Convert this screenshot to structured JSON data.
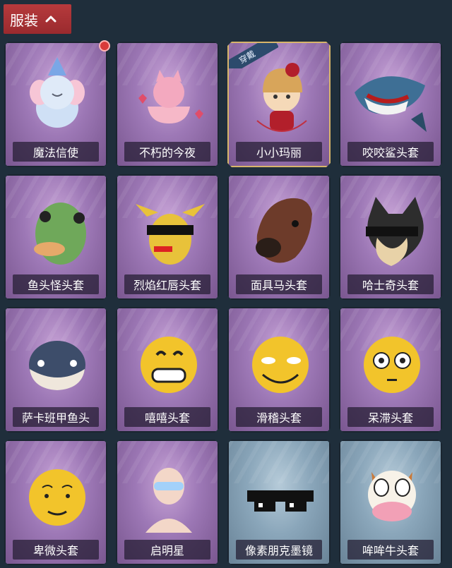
{
  "header": {
    "title": "服装",
    "chevron_icon": "chevron-up-icon",
    "bg_color": "#a82f33"
  },
  "items": [
    {
      "name": "魔法信使",
      "icon": "elephant-plush-icon",
      "theme": "purple",
      "badge": "",
      "new_dot": true
    },
    {
      "name": "不朽的今夜",
      "icon": "pink-cat-bowl-icon",
      "theme": "purple",
      "badge": "",
      "new_dot": false
    },
    {
      "name": "小小玛丽",
      "icon": "doll-mary-icon",
      "theme": "purple",
      "badge": "穿戴",
      "new_dot": false,
      "selected": true
    },
    {
      "name": "咬咬鲨头套",
      "icon": "shark-head-icon",
      "theme": "purple",
      "badge": "",
      "new_dot": false
    },
    {
      "name": "鱼头怪头套",
      "icon": "fish-head-icon",
      "theme": "purple",
      "badge": "",
      "new_dot": false
    },
    {
      "name": "烈焰红唇头套",
      "icon": "yellow-hood-sunglasses-icon",
      "theme": "purple",
      "badge": "",
      "new_dot": false
    },
    {
      "name": "面具马头套",
      "icon": "horse-mask-icon",
      "theme": "purple",
      "badge": "",
      "new_dot": false
    },
    {
      "name": "哈士奇头套",
      "icon": "husky-head-icon",
      "theme": "purple",
      "badge": "",
      "new_dot": false
    },
    {
      "name": "萨卡班甲鱼头",
      "icon": "fish-ball-head-icon",
      "theme": "purple",
      "badge": "",
      "new_dot": false
    },
    {
      "name": "嘻嘻头套",
      "icon": "grin-emoji-icon",
      "theme": "purple",
      "badge": "",
      "new_dot": false
    },
    {
      "name": "滑稽头套",
      "icon": "smirk-emoji-icon",
      "theme": "purple",
      "badge": "",
      "new_dot": false
    },
    {
      "name": "呆滞头套",
      "icon": "dazed-emoji-icon",
      "theme": "purple",
      "badge": "",
      "new_dot": false
    },
    {
      "name": "卑微头套",
      "icon": "pleading-emoji-icon",
      "theme": "purple",
      "badge": "",
      "new_dot": false
    },
    {
      "name": "启明星",
      "icon": "glowing-glasses-figure-icon",
      "theme": "purple",
      "badge": "",
      "new_dot": false
    },
    {
      "name": "像素朋克墨镜",
      "icon": "pixel-sunglasses-icon",
      "theme": "blue",
      "badge": "",
      "new_dot": false
    },
    {
      "name": "哞哞牛头套",
      "icon": "cow-head-icon",
      "theme": "blue",
      "badge": "",
      "new_dot": false
    }
  ]
}
